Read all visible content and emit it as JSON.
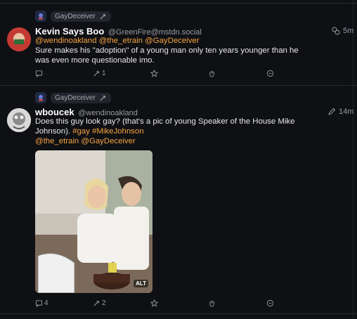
{
  "posts": [
    {
      "boosted_by": "GayDeceiver",
      "author_name": "Kevin Says Boo",
      "author_handle": "@GreenFire@mstdn.social",
      "time": "5m",
      "mentions": [
        "@wendinoakland",
        "@the_etrain",
        "@GayDeceiver"
      ],
      "text": "Sure makes his \"adoption\" of a young man only ten years younger than he was even more questionable imo.",
      "reply_count": "",
      "boost_count": "1"
    },
    {
      "boosted_by": "GayDeceiver",
      "author_name": "wboucek",
      "author_handle": "@wendinoakland",
      "time": "14m",
      "text": "Does this guy look gay? (that's a pic of young Speaker of the House Mike Johnson).",
      "hashtags": [
        "#gay",
        "#MikeJohnson"
      ],
      "mentions": [
        "@the_etrain",
        "@GayDeceiver"
      ],
      "image_alt_badge": "ALT",
      "reply_count": "4",
      "boost_count": "2"
    }
  ]
}
